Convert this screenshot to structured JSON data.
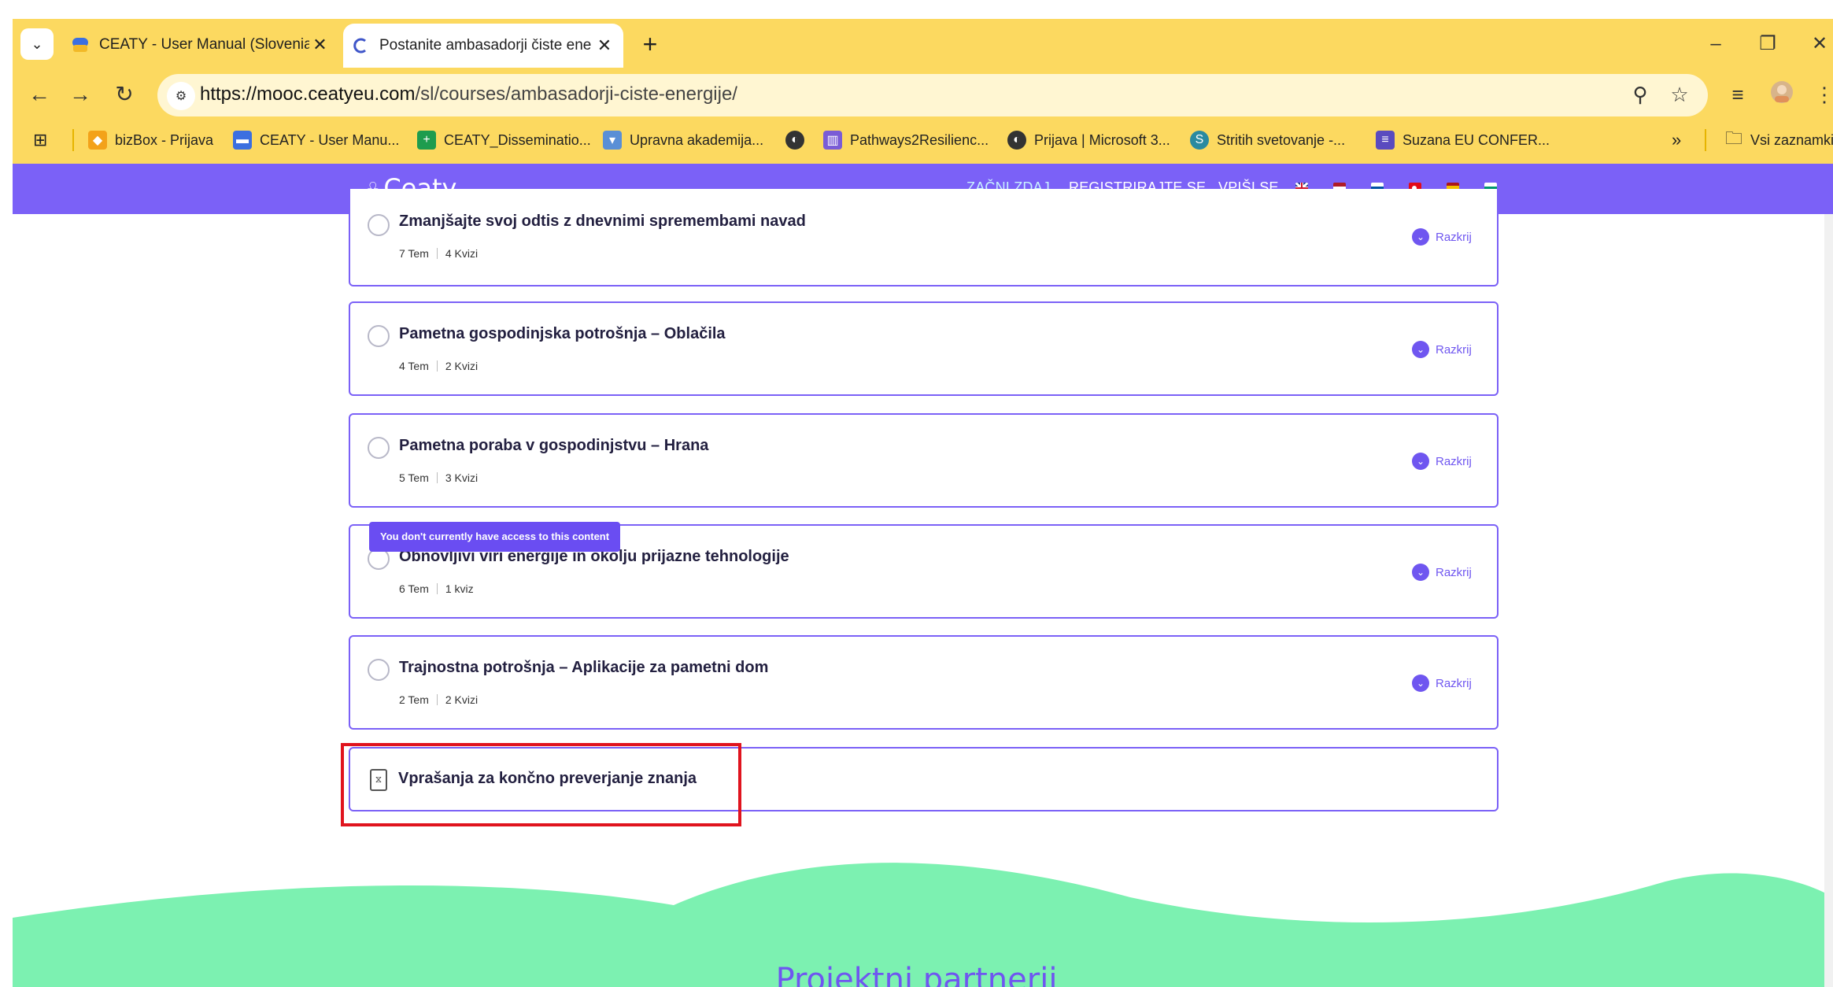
{
  "browser": {
    "tabs": [
      {
        "title": "CEATY - User Manual (Slovenia)",
        "active": false
      },
      {
        "title": "Postanite ambasadorji čiste ene",
        "active": true
      }
    ],
    "new_tab_label": "+",
    "tab_close": "✕",
    "url_host": "https://mooc.ceatyeu.com",
    "url_path": "/sl/courses/ambasadorji-ciste-energije/",
    "bookmarks": [
      "bizBox - Prijava",
      "CEATY - User Manu...",
      "CEATY_Disseminatio...",
      "Upravna akademija...",
      "",
      "Pathways2Resilienc...",
      "Prijava | Microsoft 3...",
      "Stritih svetovanje -...",
      "Suzana EU CONFER..."
    ],
    "bookmarks_more": "»",
    "bookmarks_folder": "Vsi zaznamki"
  },
  "site": {
    "logo": "Ceaty.",
    "nav": [
      "ZAČNI ZDAJ",
      "REGISTRIRAJTE SE",
      "VPIŠI SE"
    ]
  },
  "modules": [
    {
      "title": "Zmanjšajte svoj odtis z dnevnimi spremembami navad",
      "topics": "7 Tem",
      "quizzes": "4 Kvizi",
      "toggle": "Razkrij"
    },
    {
      "title": "Pametna gospodinjska potrošnja – Oblačila",
      "topics": "4 Tem",
      "quizzes": "2 Kvizi",
      "toggle": "Razkrij"
    },
    {
      "title": "Pametna poraba v gospodinjstvu – Hrana",
      "topics": "5 Tem",
      "quizzes": "3 Kvizi",
      "toggle": "Razkrij"
    },
    {
      "title": "Obnovljivi viri energije in okolju prijazne tehnologije",
      "topics": "6 Tem",
      "quizzes": "1 kviz",
      "toggle": "Razkrij"
    },
    {
      "title": "Trajnostna potrošnja – Aplikacije za pametni dom",
      "topics": "2 Tem",
      "quizzes": "2 Kvizi",
      "toggle": "Razkrij"
    }
  ],
  "tooltip": "You don't currently have access to this content",
  "final_quiz": {
    "title": "Vprašanja za končno preverjanje znanja"
  },
  "footer": {
    "heading": "Projektni partnerji"
  },
  "colors": {
    "accent": "#7b61f7",
    "chrome": "#fcd960",
    "footer_green": "#7cf1b1",
    "highlight": "#e0141e"
  }
}
